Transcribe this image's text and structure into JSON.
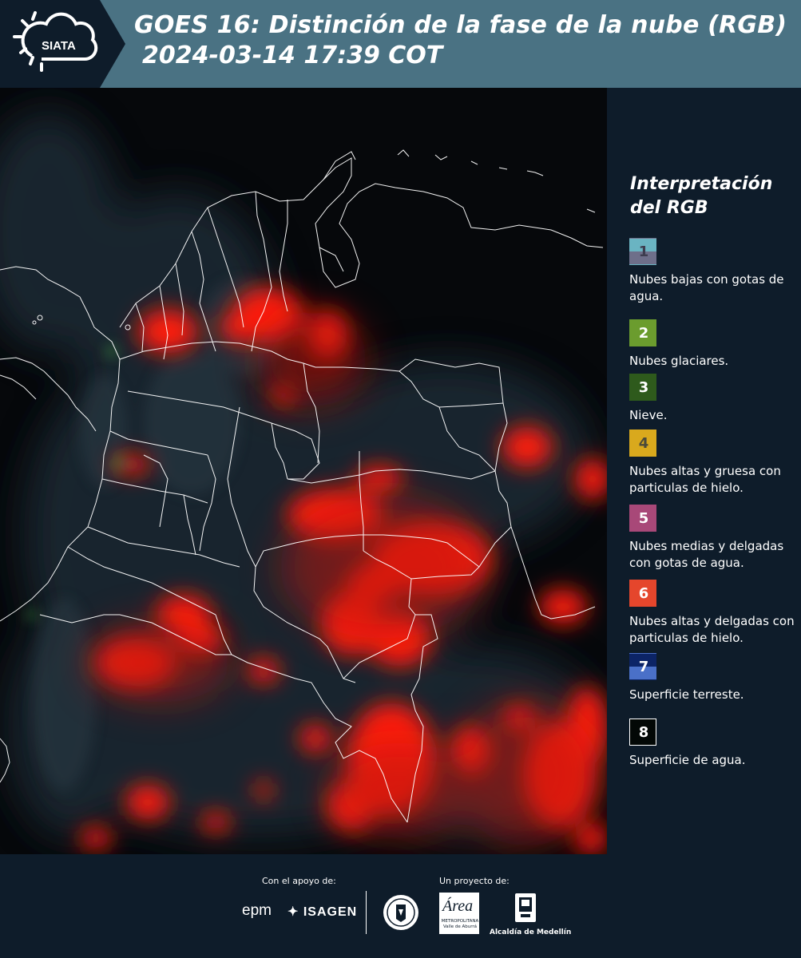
{
  "header": {
    "logo_text": "SIATA",
    "title_line1": "GOES 16: Distinción de la fase de la nube (RGB)",
    "title_line2": "2024-03-14 17:39 COT"
  },
  "legend": {
    "title": "Interpretación del RGB",
    "items": [
      {
        "number": "1",
        "label": "Nubes bajas con gotas de agua.",
        "color_top": "#6ab4c2",
        "color_bottom": "#6e6f8a",
        "number_color": "#3d3d4f"
      },
      {
        "number": "2",
        "label": "Nubes glaciares.",
        "color_top": "#6b9c2e",
        "color_bottom": "#6b9c2e",
        "number_color": "#ffffff"
      },
      {
        "number": "3",
        "label": "Nieve.",
        "color_top": "#2e5a1c",
        "color_bottom": "#2e5a1c",
        "number_color": "#ffffff"
      },
      {
        "number": "4",
        "label": "Nubes altas y gruesa con particulas de hielo.",
        "color_top": "#d9a91d",
        "color_bottom": "#d9a91d",
        "number_color": "#4a4a3a"
      },
      {
        "number": "5",
        "label": "Nubes medias y delgadas con gotas de agua.",
        "color_top": "#a84878",
        "color_bottom": "#a84878",
        "number_color": "#ffffff"
      },
      {
        "number": "6",
        "label": "Nubes altas y delgadas con particulas de hielo.",
        "color_top": "#e5462c",
        "color_bottom": "#e5462c",
        "number_color": "#ffffff"
      },
      {
        "number": "7",
        "label": "Superficie terreste.",
        "color_top": "#0c2466",
        "color_bottom": "#4a70c8",
        "number_color": "#ffffff"
      },
      {
        "number": "8",
        "label": "Superficie de agua.",
        "color_top": "#030806",
        "color_bottom": "#030806",
        "number_color": "#ffffff"
      }
    ]
  },
  "footer": {
    "support_label": "Con el apoyo de:",
    "project_label": "Un proyecto de:",
    "epm_text": "epm",
    "isagen_text": "ISAGEN",
    "area_text": "Área",
    "area_subtext": "METROPOLITANA Valle de Aburrá",
    "medellin_text": "Alcaldía de Medellín"
  },
  "colors": {
    "header_bg": "#4a7283",
    "panel_bg": "#0e1c2a",
    "cloud_red": "#ff2a1a",
    "boundary": "#ffffff"
  }
}
